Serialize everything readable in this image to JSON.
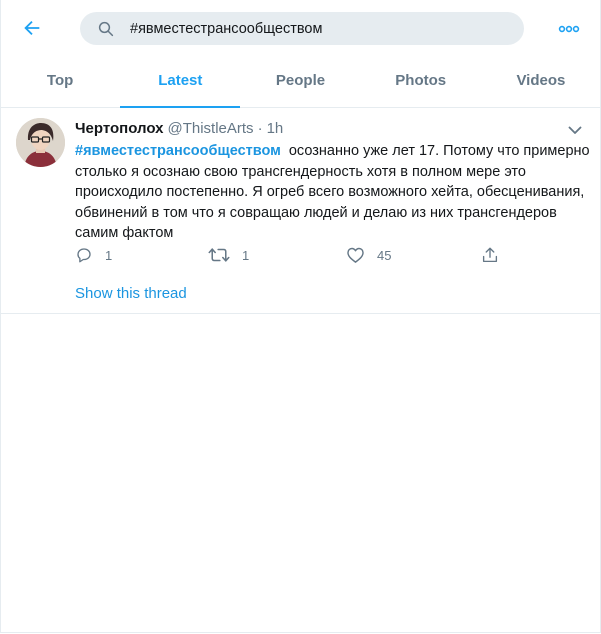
{
  "search": {
    "query": "#явместестрансообществом"
  },
  "tabs": [
    {
      "label": "Top"
    },
    {
      "label": "Latest"
    },
    {
      "label": "People"
    },
    {
      "label": "Photos"
    },
    {
      "label": "Videos"
    }
  ],
  "active_tab": "Latest",
  "tweet": {
    "display_name": "Чертополох",
    "handle": "@ThistleArts",
    "separator": "·",
    "time": "1h",
    "hashtag": "#явместестрансообществом",
    "text": "осознанно уже лет 17. Потому что примерно столько я осознаю свою трансгендерность хотя в полном мере это происходило постепенно. Я огреб всего возможного хейта, обесценивания, обвинений в том что я совращаю людей и делаю из них трансгендеров самим фактом",
    "reply_count": "1",
    "retweet_count": "1",
    "like_count": "45",
    "show_thread_label": "Show this thread"
  },
  "icons": {
    "back": "arrow-left-icon",
    "search": "search-icon",
    "more": "more-horizontal-icon",
    "caret": "chevron-down-icon",
    "reply": "reply-icon",
    "retweet": "retweet-icon",
    "like": "heart-icon",
    "share": "share-icon"
  },
  "colors": {
    "accent": "#1da1f2",
    "link": "#1b95e0",
    "muted": "#657786",
    "text": "#14171a",
    "search_bg": "#e6ecf0",
    "border": "#e6ecf0"
  }
}
